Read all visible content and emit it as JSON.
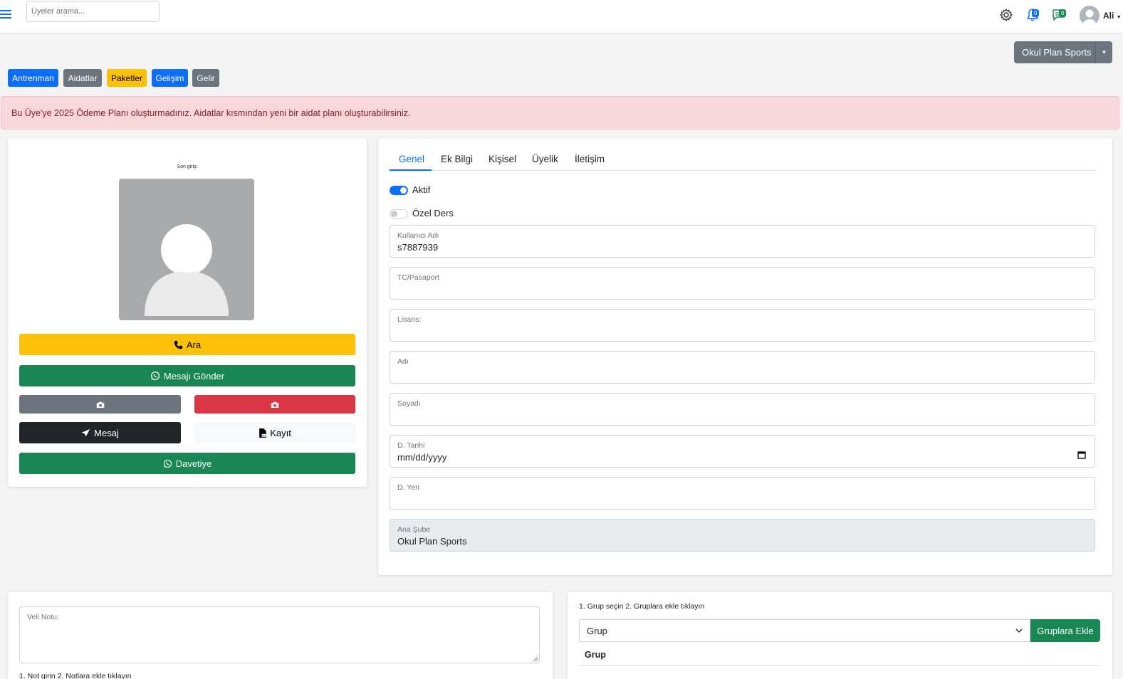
{
  "topbar": {
    "search_placeholder": "Üyeler arama...",
    "notifications_count": "0",
    "messages_count": "0",
    "user_name": "Ali"
  },
  "branch_selector": {
    "label": "Okul Plan Sports"
  },
  "nav_buttons": [
    {
      "label": "Antrenman",
      "color": "#0d6efd"
    },
    {
      "label": "Aidatlar",
      "color": "#6c757d"
    },
    {
      "label": "Paketler",
      "color": "#ffc107"
    },
    {
      "label": "Gelişim",
      "color": "#0d6efd"
    },
    {
      "label": "Gelir",
      "color": "#6c757d"
    }
  ],
  "alert": {
    "text": "Bu Üye'ye 2025 Ödeme Planı oluşturmadınız. Aidatlar kısmından yeni bir aidat planı oluşturabilirsiniz."
  },
  "profile": {
    "last_login_label": "Son giriş:",
    "call_label": "Ara",
    "whatsapp_label": "Mesajı Gönder",
    "message_label": "Mesaj",
    "record_label": "Kayıt",
    "invite_label": "Davetiye"
  },
  "tabs": [
    {
      "label": "Genel",
      "active": true
    },
    {
      "label": "Ek Bilgi",
      "active": false
    },
    {
      "label": "Kişisel",
      "active": false
    },
    {
      "label": "Üyelik",
      "active": false
    },
    {
      "label": "İletişim",
      "active": false
    }
  ],
  "switches": {
    "active": {
      "label": "Aktif",
      "checked": true
    },
    "private_lesson": {
      "label": "Özel Ders",
      "checked": false
    }
  },
  "fields": {
    "username": {
      "label": "Kullanıcı Adı",
      "value": "s7887939"
    },
    "tc_passport": {
      "label": "TC/Pasaport",
      "value": ""
    },
    "license": {
      "label": "Lisans:",
      "value": ""
    },
    "first_name": {
      "label": "Adı",
      "value": ""
    },
    "last_name": {
      "label": "Soyadı",
      "value": ""
    },
    "birth_date": {
      "label": "D. Tarihi",
      "value": "mm/dd/yyyy"
    },
    "birth_place": {
      "label": "D. Yeri",
      "value": ""
    },
    "main_branch": {
      "label": "Ana Şube",
      "value": "Okul Plan Sports"
    }
  },
  "notes": {
    "parent_note_label": "Veli Notu:",
    "hint": "1. Not girin 2. Notlara ekle tıklayın"
  },
  "groups": {
    "hint": "1. Grup seçin 2. Gruplara ekle tıklayın",
    "select_value": "Grup",
    "add_button": "Gruplara Ekle",
    "table_header": "Grup"
  }
}
